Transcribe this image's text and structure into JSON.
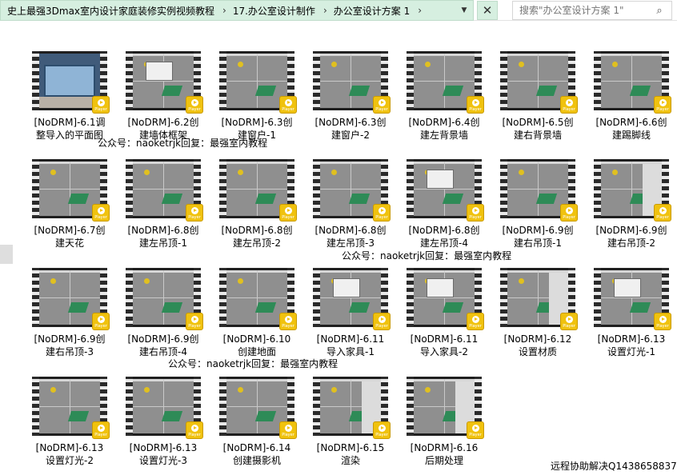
{
  "address_bar": {
    "path": [
      "史上最强3Dmax室内设计家庭装修实例视频教程",
      "17.办公室设计制作",
      "办公室设计方案 1"
    ]
  },
  "search": {
    "placeholder": "搜索\"办公室设计方案 1\""
  },
  "icons": {
    "close": "close-icon",
    "search": "search-icon",
    "dropdown": "chevron-down-icon",
    "player": "play-icon"
  },
  "badge_text": "Player",
  "items": [
    {
      "line1": "[NoDRM]-6.1调",
      "line2": "整导入的平面图",
      "thumb": "render"
    },
    {
      "line1": "[NoDRM]-6.2创",
      "line2": "建墙体框架",
      "thumb": "dialog"
    },
    {
      "line1": "[NoDRM]-6.3创",
      "line2": "建窗户-1",
      "thumb": "shape"
    },
    {
      "line1": "[NoDRM]-6.3创",
      "line2": "建窗户-2",
      "thumb": "shape"
    },
    {
      "line1": "[NoDRM]-6.4创",
      "line2": "建左背景墙",
      "thumb": "shape"
    },
    {
      "line1": "[NoDRM]-6.5创",
      "line2": "建右背景墙",
      "thumb": "shape"
    },
    {
      "line1": "[NoDRM]-6.6创",
      "line2": "建踢脚线",
      "thumb": "shape"
    },
    {
      "line1": "[NoDRM]-6.7创",
      "line2": "建天花",
      "thumb": "shape"
    },
    {
      "line1": "[NoDRM]-6.8创",
      "line2": "建左吊顶-1",
      "thumb": "shape"
    },
    {
      "line1": "[NoDRM]-6.8创",
      "line2": "建左吊顶-2",
      "thumb": "shape"
    },
    {
      "line1": "[NoDRM]-6.8创",
      "line2": "建左吊顶-3",
      "thumb": "shape"
    },
    {
      "line1": "[NoDRM]-6.8创",
      "line2": "建左吊顶-4",
      "thumb": "dialog"
    },
    {
      "line1": "[NoDRM]-6.9创",
      "line2": "建右吊顶-1",
      "thumb": "shape"
    },
    {
      "line1": "[NoDRM]-6.9创",
      "line2": "建右吊顶-2",
      "thumb": "panel"
    },
    {
      "line1": "[NoDRM]-6.9创",
      "line2": "建右吊顶-3",
      "thumb": "shape"
    },
    {
      "line1": "[NoDRM]-6.9创",
      "line2": "建右吊顶-4",
      "thumb": "shape"
    },
    {
      "line1": "[NoDRM]-6.10",
      "line2": "创建地面",
      "thumb": "shape"
    },
    {
      "line1": "[NoDRM]-6.11",
      "line2": "导入家具-1",
      "thumb": "dialog"
    },
    {
      "line1": "[NoDRM]-6.11",
      "line2": "导入家具-2",
      "thumb": "dialog"
    },
    {
      "line1": "[NoDRM]-6.12",
      "line2": "设置材质",
      "thumb": "panel"
    },
    {
      "line1": "[NoDRM]-6.13",
      "line2": "设置灯光-1",
      "thumb": "dialog"
    },
    {
      "line1": "[NoDRM]-6.13",
      "line2": "设置灯光-2",
      "thumb": "shape"
    },
    {
      "line1": "[NoDRM]-6.13",
      "line2": "设置灯光-3",
      "thumb": "shape"
    },
    {
      "line1": "[NoDRM]-6.14",
      "line2": "创建摄影机",
      "thumb": "shape"
    },
    {
      "line1": "[NoDRM]-6.15",
      "line2": "渲染",
      "thumb": "panel"
    },
    {
      "line1": "[NoDRM]-6.16",
      "line2": "后期处理",
      "thumb": "panel"
    }
  ],
  "watermark_text": "公众号：naoketrjk回复：最强室内教程",
  "footer_text": "远程协助解决Q1438658837"
}
